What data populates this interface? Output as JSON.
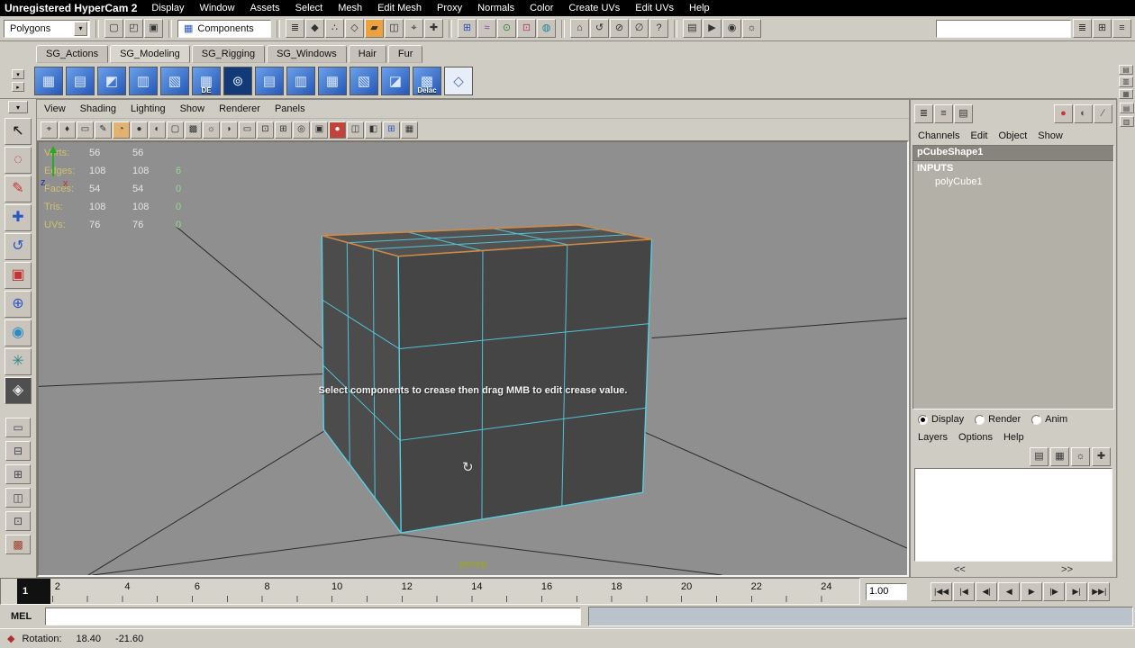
{
  "titlebar": {
    "app_title": "Unregistered HyperCam 2",
    "menus": [
      {
        "label": "Display"
      },
      {
        "label": "Window"
      },
      {
        "label": "Assets"
      },
      {
        "label": "Select"
      },
      {
        "label": "Mesh"
      },
      {
        "label": "Edit Mesh"
      },
      {
        "label": "Proxy"
      },
      {
        "label": "Normals"
      },
      {
        "label": "Color"
      },
      {
        "label": "Create UVs"
      },
      {
        "label": "Edit UVs"
      },
      {
        "label": "Help"
      }
    ]
  },
  "statusline": {
    "mode_dropdown": {
      "value": "Polygons",
      "arrow": "▾"
    },
    "file_icons": [
      {
        "name": "scene-new-icon",
        "glyph": "▢"
      },
      {
        "name": "scene-open-icon",
        "glyph": "◰"
      },
      {
        "name": "scene-save-icon",
        "glyph": "▣"
      }
    ],
    "selection_mode": {
      "label": "Components",
      "icon_glyph": "▦"
    },
    "mask_icons": [
      {
        "name": "select-hierarchy-icon",
        "glyph": "≣"
      },
      {
        "name": "select-object-icon",
        "glyph": "◆"
      },
      {
        "name": "select-component-points-icon",
        "glyph": "∴"
      },
      {
        "name": "select-component-lines-icon",
        "glyph": "◇"
      },
      {
        "name": "select-component-faces-icon",
        "glyph": "▰",
        "bg": "#eda23f"
      },
      {
        "name": "select-component-hulls-icon",
        "glyph": "◫"
      },
      {
        "name": "select-pivots-icon",
        "glyph": "⌖"
      },
      {
        "name": "select-handles-icon",
        "glyph": "✚"
      }
    ],
    "snap_icons": [
      {
        "name": "snap-grid-icon",
        "glyph": "⊞",
        "fg": "#2a52b8"
      },
      {
        "name": "snap-curve-icon",
        "glyph": "≈",
        "fg": "#7a3ab8"
      },
      {
        "name": "snap-point-icon",
        "glyph": "⊙",
        "fg": "#2a8838"
      },
      {
        "name": "snap-plane-icon",
        "glyph": "⊡",
        "fg": "#b83a68"
      },
      {
        "name": "make-live-icon",
        "glyph": "◍",
        "fg": "#188898"
      }
    ],
    "history_icons": [
      {
        "name": "input-to-selected-icon",
        "glyph": "⌂"
      },
      {
        "name": "construction-history-icon",
        "glyph": "↺"
      },
      {
        "name": "no-construction-history-icon",
        "glyph": "⊘"
      },
      {
        "name": "lock-selection-icon",
        "glyph": "∅"
      },
      {
        "name": "help-icon",
        "glyph": "?"
      }
    ],
    "render_icons": [
      {
        "name": "render-view-icon",
        "glyph": "▤"
      },
      {
        "name": "render-current-frame-icon",
        "glyph": "▶"
      },
      {
        "name": "ipr-render-icon",
        "glyph": "◉"
      },
      {
        "name": "render-settings-icon",
        "glyph": "☼"
      }
    ],
    "sidebar_icons": [
      {
        "name": "show-attribute-editor-icon",
        "glyph": "≣"
      },
      {
        "name": "show-tool-settings-icon",
        "glyph": "⊞"
      },
      {
        "name": "show-channel-box-icon",
        "glyph": "≡"
      }
    ]
  },
  "shelf": {
    "tabs": [
      {
        "label": "SG_Actions",
        "bg": "#c6c2ba"
      },
      {
        "label": "SG_Modeling",
        "bg": "#d8d5cd"
      },
      {
        "label": "SG_Rigging",
        "bg": "#c6c2ba"
      },
      {
        "label": "SG_Windows",
        "bg": "#c6c2ba"
      },
      {
        "label": "Hair",
        "bg": "#c6c2ba"
      },
      {
        "label": "Fur",
        "bg": "#c6c2ba"
      }
    ],
    "gutter": [
      {
        "name": "shelf-menu-icon",
        "glyph": "▾"
      },
      {
        "name": "shelf-overflow-icon",
        "glyph": "▸"
      }
    ],
    "items": [
      {
        "name": "shelf-smooth-icon",
        "glyph": "▦"
      },
      {
        "name": "shelf-subdiv-proxy-icon",
        "glyph": "▤"
      },
      {
        "name": "shelf-select-icon",
        "glyph": "◩"
      },
      {
        "name": "shelf-extrude-icon",
        "glyph": "▥"
      },
      {
        "name": "shelf-bridge-icon",
        "glyph": "▧"
      },
      {
        "name": "shelf-de-icon",
        "glyph": "▦",
        "caption": "DE"
      },
      {
        "name": "shelf-sphere-icon",
        "glyph": "⊚",
        "bg": "#123a78"
      },
      {
        "name": "shelf-combine-icon",
        "glyph": "▤"
      },
      {
        "name": "shelf-split-icon",
        "glyph": "▥"
      },
      {
        "name": "shelf-merge-icon",
        "glyph": "▦"
      },
      {
        "name": "shelf-mirror-icon",
        "glyph": "▧"
      },
      {
        "name": "shelf-crease-icon",
        "glyph": "◪"
      },
      {
        "name": "shelf-delac-icon",
        "glyph": "▩",
        "caption": "Delac"
      },
      {
        "name": "shelf-cube-wire-icon",
        "glyph": "◇",
        "bg": "#e8eef8",
        "fg": "#4468c8"
      }
    ]
  },
  "toolbox": {
    "menu_glyph": "▾",
    "tools": [
      {
        "name": "select-tool",
        "glyph": "↖",
        "fg": "#101010"
      },
      {
        "name": "lasso-tool",
        "glyph": "◌",
        "fg": "#b03030"
      },
      {
        "name": "paint-select-tool",
        "glyph": "✎",
        "fg": "#c23535"
      },
      {
        "name": "move-tool",
        "glyph": "✚",
        "fg": "#2b57c4"
      },
      {
        "name": "rotate-tool",
        "glyph": "↺",
        "fg": "#2b57c4"
      },
      {
        "name": "scale-tool",
        "glyph": "▣",
        "fg": "#c23535"
      },
      {
        "name": "universal-manipulator-tool",
        "glyph": "⊕",
        "fg": "#2b57c4"
      },
      {
        "name": "soft-mod-tool",
        "glyph": "◉",
        "fg": "#2b8ac4"
      },
      {
        "name": "show-manipulator-tool",
        "glyph": "✳",
        "fg": "#28888a"
      },
      {
        "name": "crease-tool-current",
        "glyph": "◈",
        "fg": "#e8e8e8",
        "bg": "#4f4f4f"
      }
    ],
    "layouts": [
      {
        "name": "layout-single-pane-button",
        "glyph": "▭"
      },
      {
        "name": "layout-two-pane-button",
        "glyph": "⊟"
      },
      {
        "name": "layout-four-pane-button",
        "glyph": "⊞"
      },
      {
        "name": "layout-persp-outliner-button",
        "glyph": "◫"
      },
      {
        "name": "layout-persp-graph-button",
        "glyph": "⊡"
      },
      {
        "name": "layout-hypershade-button",
        "glyph": "▩",
        "fg": "#a04028"
      }
    ]
  },
  "viewport": {
    "menus": [
      {
        "label": "View"
      },
      {
        "label": "Shading"
      },
      {
        "label": "Lighting"
      },
      {
        "label": "Show"
      },
      {
        "label": "Renderer"
      },
      {
        "label": "Panels"
      }
    ],
    "toolbar_icons": [
      {
        "name": "camera-select-icon",
        "glyph": "⌖"
      },
      {
        "name": "camera-bookmark-icon",
        "glyph": "♦"
      },
      {
        "name": "image-plane-icon",
        "glyph": "▭"
      },
      {
        "name": "grease-pencil-icon",
        "glyph": "✎"
      },
      {
        "name": "wireframe-icon",
        "glyph": "◔",
        "bg": "#e2b271"
      },
      {
        "name": "smooth-shade-icon",
        "glyph": "●"
      },
      {
        "name": "flat-shade-icon",
        "glyph": "◐"
      },
      {
        "name": "bounding-box-icon",
        "glyph": "▢"
      },
      {
        "name": "textured-icon",
        "glyph": "▩"
      },
      {
        "name": "lights-icon",
        "glyph": "☼"
      },
      {
        "name": "shadows-icon",
        "glyph": "◗"
      },
      {
        "name": "film-gate-icon",
        "glyph": "▭"
      },
      {
        "name": "resolution-gate-icon",
        "glyph": "⊡"
      },
      {
        "name": "field-chart-icon",
        "glyph": "⊞"
      },
      {
        "name": "safe-action-icon",
        "glyph": "◎"
      },
      {
        "name": "safe-title-icon",
        "glyph": "▣"
      },
      {
        "name": "default-material-icon",
        "glyph": "●",
        "bg": "#c2433a",
        "fg": "#ffffff"
      },
      {
        "name": "xray-icon",
        "glyph": "◫"
      },
      {
        "name": "isolate-select-icon",
        "glyph": "◧"
      },
      {
        "name": "grid-toggle-icon",
        "glyph": "⊞",
        "fg": "#2b57c4"
      },
      {
        "name": "texture-borders-icon",
        "glyph": "▦"
      }
    ],
    "hud_stats": [
      {
        "label": "Verts:",
        "c1": "56",
        "c2": "56",
        "c3": ""
      },
      {
        "label": "Edges:",
        "c1": "108",
        "c2": "108",
        "c3": "6"
      },
      {
        "label": "Faces:",
        "c1": "54",
        "c2": "54",
        "c3": "0"
      },
      {
        "label": "Tris:",
        "c1": "108",
        "c2": "108",
        "c3": "0"
      },
      {
        "label": "UVs:",
        "c1": "76",
        "c2": "76",
        "c3": "0"
      }
    ],
    "message": "Select components to crease then drag MMB to edit crease value.",
    "camera_label": "persp",
    "orbit_glyph": "↻",
    "axis": {
      "x_label": "x",
      "z_label": "z"
    },
    "colors": {
      "wireframe": "#58cfe3",
      "crease_highlight": "#cf8a49",
      "background": "#8f8f8f"
    }
  },
  "channel_box": {
    "tab_icons": [
      {
        "name": "channel-box-tab-icon",
        "glyph": "≣"
      },
      {
        "name": "layer-editor-tab-icon",
        "glyph": "≡"
      },
      {
        "name": "channel-layer-tab-icon",
        "glyph": "▤"
      }
    ],
    "status_icons": [
      {
        "name": "select-highlight-icon",
        "glyph": "●",
        "fg": "#c03838"
      },
      {
        "name": "shaded-toggle-icon",
        "glyph": "◐",
        "fg": "#555555"
      },
      {
        "name": "slash-icon",
        "glyph": "∕",
        "fg": "#555555"
      }
    ],
    "menus": [
      {
        "label": "Channels"
      },
      {
        "label": "Edit"
      },
      {
        "label": "Object"
      },
      {
        "label": "Show"
      }
    ],
    "shape_name": "pCubeShape1",
    "inputs_label": "INPUTS",
    "input_node": "polyCube1"
  },
  "layer_editor": {
    "radios": [
      {
        "name": "display-radio",
        "label": "Display",
        "dotColor": "#000000"
      },
      {
        "name": "render-radio",
        "label": "Render",
        "dotColor": "transparent"
      },
      {
        "name": "anim-radio",
        "label": "Anim",
        "dotColor": "transparent"
      }
    ],
    "menus": [
      {
        "label": "Layers"
      },
      {
        "label": "Options"
      },
      {
        "label": "Help"
      }
    ],
    "icons": [
      {
        "name": "layer-new-empty-icon",
        "glyph": "▤"
      },
      {
        "name": "layer-new-from-selected-icon",
        "glyph": "▦"
      },
      {
        "name": "layer-lighting-icon",
        "glyph": "☼"
      },
      {
        "name": "layer-move-icon",
        "glyph": "✚"
      }
    ],
    "pager_left": "<<",
    "pager_right": ">>"
  },
  "right_strip": {
    "shelf_icons": [
      {
        "name": "shelf-arrange-1-icon",
        "glyph": "▤"
      },
      {
        "name": "shelf-arrange-2-icon",
        "glyph": "▥"
      },
      {
        "name": "shelf-arrange-3-icon",
        "glyph": "▦"
      }
    ],
    "panel_icons": [
      {
        "name": "panel-toggle-1-icon",
        "glyph": "▤"
      },
      {
        "name": "panel-toggle-2-icon",
        "glyph": "▥"
      }
    ]
  },
  "timeline": {
    "current_frame": "1",
    "ticks": [
      "2",
      "4",
      "6",
      "8",
      "10",
      "12",
      "14",
      "16",
      "18",
      "20",
      "22",
      "24"
    ],
    "time_field": "1.00",
    "playback": [
      {
        "name": "go-to-start-button",
        "glyph": "|◀◀"
      },
      {
        "name": "step-back-key-button",
        "glyph": "|◀"
      },
      {
        "name": "step-back-frame-button",
        "glyph": "◀|"
      },
      {
        "name": "play-backwards-button",
        "glyph": "◀"
      },
      {
        "name": "play-forward-button",
        "glyph": "▶"
      },
      {
        "name": "step-forward-frame-button",
        "glyph": "|▶"
      },
      {
        "name": "step-forward-key-button",
        "glyph": "▶|"
      },
      {
        "name": "go-to-end-button",
        "glyph": "▶▶|"
      }
    ]
  },
  "mel": {
    "label": "MEL",
    "value": ""
  },
  "helpline": {
    "icon_glyph": "◆",
    "label": "Rotation:",
    "value1": "18.40",
    "value2": "-21.60"
  }
}
